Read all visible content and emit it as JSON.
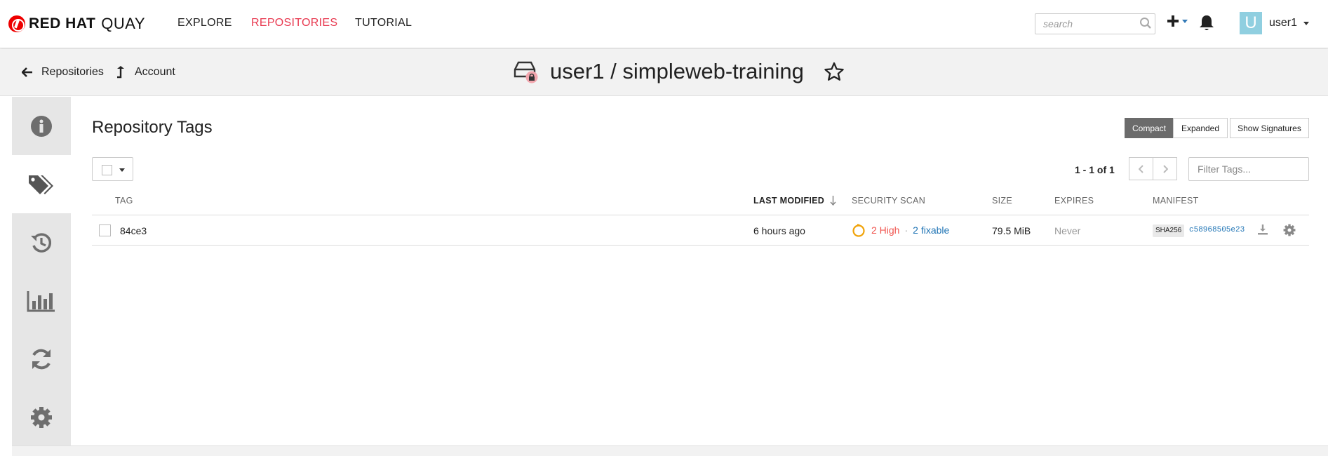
{
  "header": {
    "logo_brand": "RED HAT",
    "logo_product": "QUAY",
    "nav": [
      {
        "label": "EXPLORE",
        "active": false
      },
      {
        "label": "REPOSITORIES",
        "active": true
      },
      {
        "label": "TUTORIAL",
        "active": false
      }
    ],
    "search_placeholder": "search",
    "user": {
      "avatar_letter": "U",
      "avatar_color": "#90cfe0",
      "name": "user1"
    }
  },
  "subheader": {
    "back_label": "Repositories",
    "account_label": "Account",
    "repo_title": "user1 / simpleweb-training",
    "icons": [
      "arrow-left-icon",
      "level-up-icon",
      "private-repo-icon",
      "star-outline-icon"
    ]
  },
  "tabs": [
    {
      "name": "info",
      "icon": "info-circle-icon",
      "active": false
    },
    {
      "name": "tags",
      "icon": "tags-icon",
      "active": true
    },
    {
      "name": "history",
      "icon": "history-icon",
      "active": false
    },
    {
      "name": "usage-logs",
      "icon": "bar-chart-icon",
      "active": false
    },
    {
      "name": "builds",
      "icon": "refresh-icon",
      "active": false
    },
    {
      "name": "settings",
      "icon": "gear-icon",
      "active": false
    }
  ],
  "tags_view": {
    "title": "Repository Tags",
    "view_modes": [
      {
        "label": "Compact",
        "active": true
      },
      {
        "label": "Expanded",
        "active": false
      },
      {
        "label": "Show Signatures",
        "active": false
      }
    ],
    "paging": "1 - 1 of 1",
    "filter_placeholder": "Filter Tags...",
    "columns": {
      "tag": "TAG",
      "last_modified": "LAST MODIFIED",
      "security_scan": "SECURITY SCAN",
      "size": "SIZE",
      "expires": "EXPIRES",
      "manifest": "MANIFEST"
    },
    "sort_column": "last_modified",
    "rows": [
      {
        "tag": "84ce3",
        "last_modified": "6 hours ago",
        "scan_high": "2 High",
        "scan_separator": "·",
        "scan_fixable": "2 fixable",
        "size": "79.5 MiB",
        "expires": "Never",
        "digest_algo": "SHA256",
        "digest": "c58968505e23"
      }
    ]
  },
  "colors": {
    "accent_red": "#e8384f",
    "link_blue": "#1f74b5",
    "high_severity": "#f0544e",
    "scan_ring": "#f0a30a"
  }
}
